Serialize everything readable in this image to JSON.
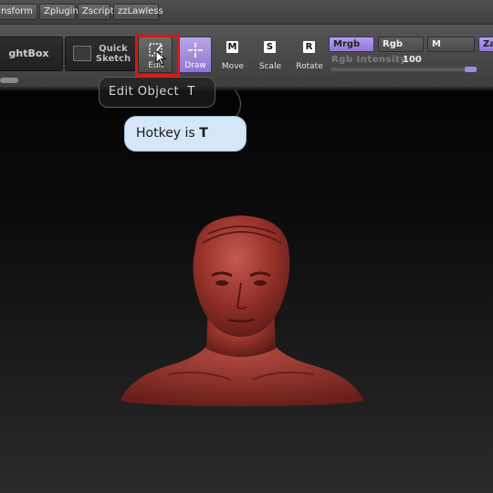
{
  "menu": {
    "items": [
      "nsform",
      "Zplugin",
      "Zscript",
      "zzLawless"
    ]
  },
  "toolbar": {
    "lightbox_label": "ghtBox",
    "quicksketch_label": "Quick\nSketch",
    "edit_label": "Edit",
    "draw_label": "Draw",
    "move_label": "Move",
    "move_key": "M",
    "scale_label": "Scale",
    "scale_key": "S",
    "rotate_label": "Rotate",
    "rotate_key": "R",
    "mrgb_label": "Mrgb",
    "rgb_label": "Rgb",
    "m_label": "M",
    "zadd_label": "Za",
    "intensity_label": "Rgb Intensity",
    "intensity_value": "100"
  },
  "tooltip": {
    "title": "Edit Object  T",
    "hotkey_prefix": "Hotkey is ",
    "hotkey_key": "T"
  },
  "colors": {
    "accent_purple": "#9f8ae0",
    "highlight_red": "#e0140e",
    "tooltip_blue": "#d4e6f7",
    "model_red": "#8a2a24"
  }
}
